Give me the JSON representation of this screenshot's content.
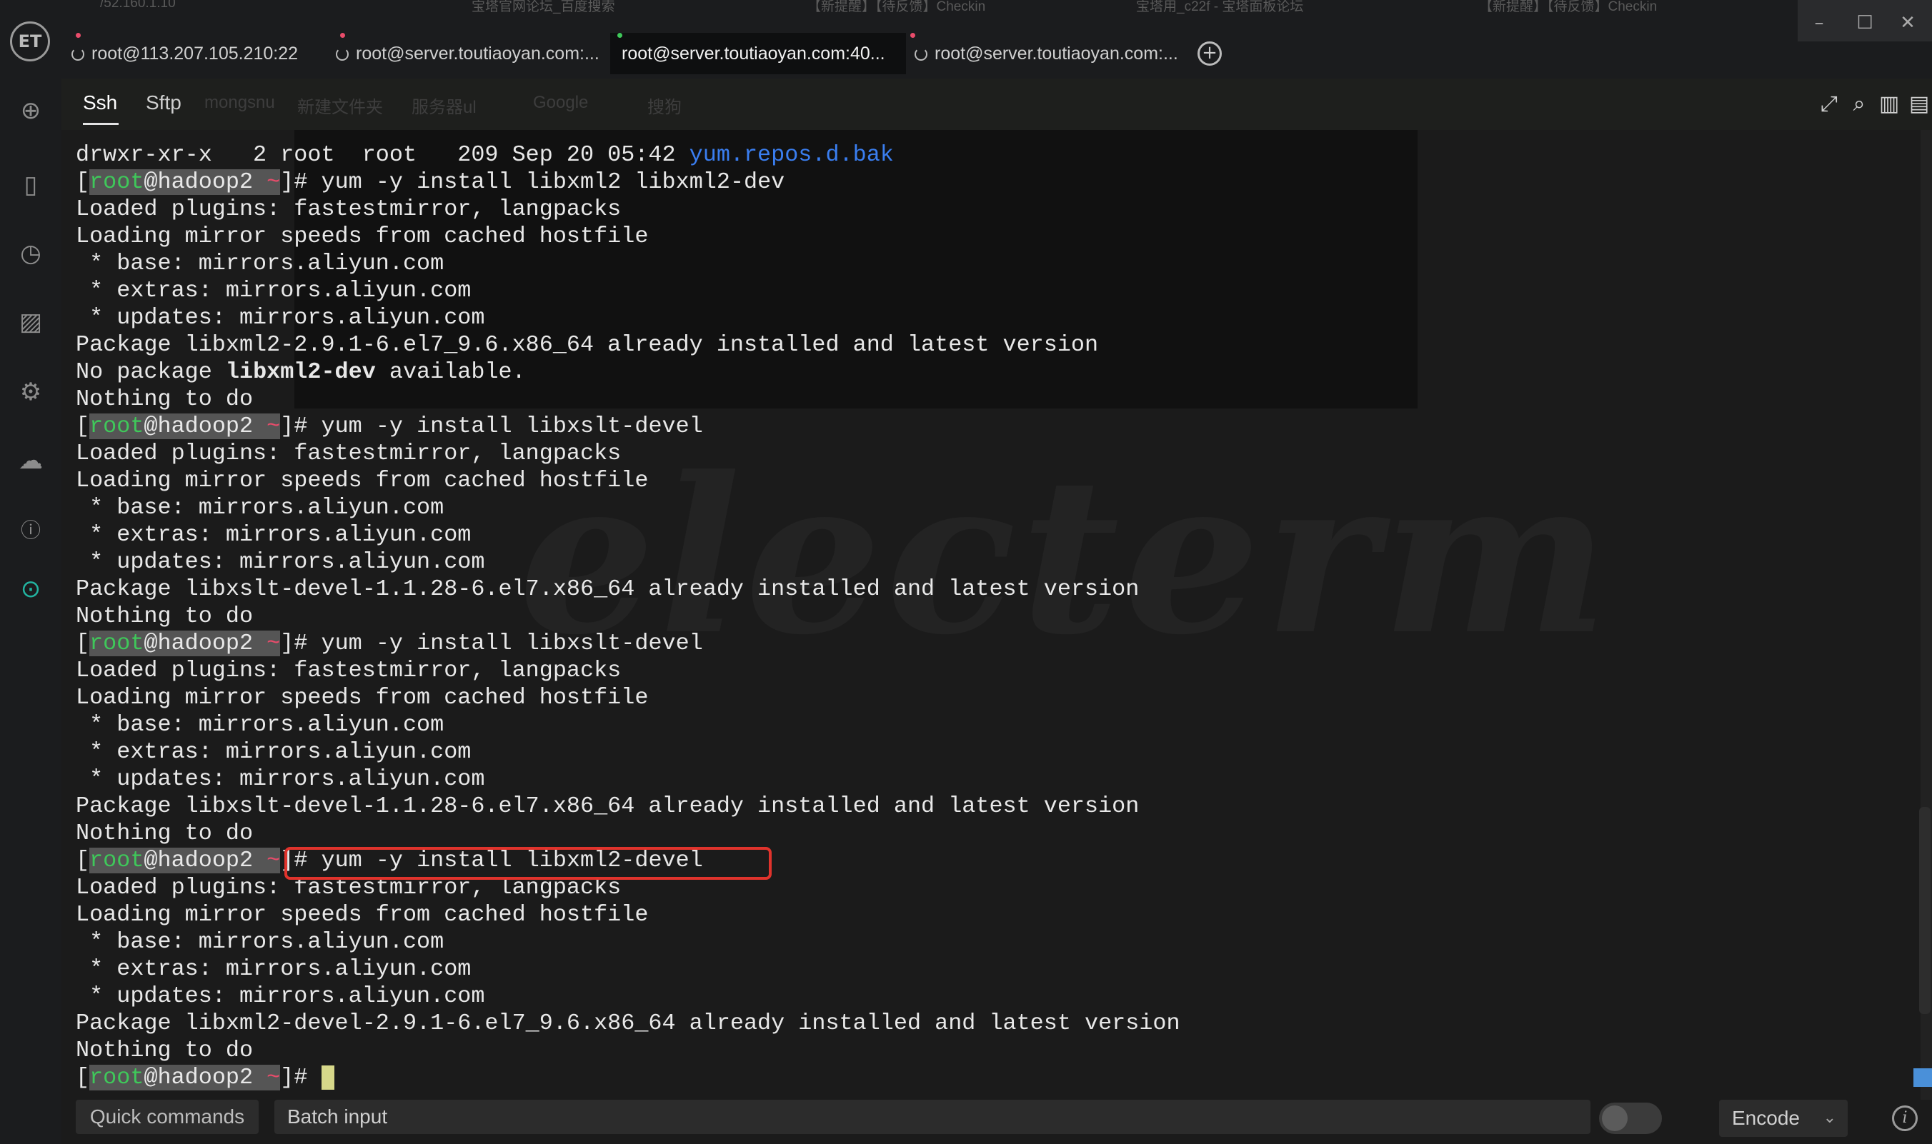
{
  "window": {
    "background_tabs": [
      "/52.160.1.10",
      "宝塔官网论坛_百度搜索",
      "【新提醒】【待反馈】Checkin",
      "宝塔用_c22f - 宝塔面板论坛",
      "【新提醒】【待反馈】Checkin"
    ],
    "controls": [
      "minimize",
      "maximize",
      "close"
    ]
  },
  "app": {
    "logo_text": "ET"
  },
  "tabs": [
    {
      "label": "root@113.207.105.210:22",
      "active": false,
      "dot_color": "#e94c6b"
    },
    {
      "label": "root@server.toutiaoyan.com:...",
      "active": false,
      "dot_color": "#e94c6b"
    },
    {
      "label": "root@server.toutiaoyan.com:40...",
      "active": true,
      "dot_color": "#3fc85a"
    },
    {
      "label": "root@server.toutiaoyan.com:...",
      "active": false,
      "dot_color": "#e94c6b"
    }
  ],
  "sidebar": {
    "icons": [
      "add-icon",
      "bookmark-icon",
      "history-icon",
      "image-icon",
      "settings-icon",
      "cloud-sync-icon",
      "info-icon",
      "upgrade-icon"
    ]
  },
  "subbar": {
    "tabs": [
      "Ssh",
      "Sftp"
    ],
    "active_tab": "Ssh",
    "ghost_bookmarks": [
      "mongsnu",
      "新建文件夹",
      "服务器ul",
      "Google",
      "搜狗"
    ],
    "tools": [
      "fullscreen-icon",
      "search-icon",
      "split-icon",
      "grid-icon"
    ]
  },
  "terminal": {
    "prompt": {
      "user": "root",
      "host": "@hadoop2",
      "dir": "~"
    },
    "lines": [
      {
        "type": "text",
        "text": "drwxr-xr-x   2 root  root   209 Sep 20 05:42 ",
        "link": "yum.repos.d.bak"
      },
      {
        "type": "prompt",
        "cmd": "# yum -y install libxml2 libxml2-dev"
      },
      {
        "type": "text",
        "text": "Loaded plugins: fastestmirror, langpacks"
      },
      {
        "type": "text",
        "text": "Loading mirror speeds from cached hostfile"
      },
      {
        "type": "text",
        "text": " * base: mirrors.aliyun.com"
      },
      {
        "type": "text",
        "text": " * extras: mirrors.aliyun.com"
      },
      {
        "type": "text",
        "text": " * updates: mirrors.aliyun.com"
      },
      {
        "type": "text",
        "text": "Package libxml2-2.9.1-6.el7_9.6.x86_64 already installed and latest version"
      },
      {
        "type": "bold",
        "pre": "No package ",
        "bold": "libxml2-dev",
        "post": " available."
      },
      {
        "type": "text",
        "text": "Nothing to do"
      },
      {
        "type": "prompt",
        "cmd": "# yum -y install libxslt-devel"
      },
      {
        "type": "text",
        "text": "Loaded plugins: fastestmirror, langpacks"
      },
      {
        "type": "text",
        "text": "Loading mirror speeds from cached hostfile"
      },
      {
        "type": "text",
        "text": " * base: mirrors.aliyun.com"
      },
      {
        "type": "text",
        "text": " * extras: mirrors.aliyun.com"
      },
      {
        "type": "text",
        "text": " * updates: mirrors.aliyun.com"
      },
      {
        "type": "text",
        "text": "Package libxslt-devel-1.1.28-6.el7.x86_64 already installed and latest version"
      },
      {
        "type": "text",
        "text": "Nothing to do"
      },
      {
        "type": "prompt",
        "cmd": "# yum -y install libxslt-devel"
      },
      {
        "type": "text",
        "text": "Loaded plugins: fastestmirror, langpacks"
      },
      {
        "type": "text",
        "text": "Loading mirror speeds from cached hostfile"
      },
      {
        "type": "text",
        "text": " * base: mirrors.aliyun.com"
      },
      {
        "type": "text",
        "text": " * extras: mirrors.aliyun.com"
      },
      {
        "type": "text",
        "text": " * updates: mirrors.aliyun.com"
      },
      {
        "type": "text",
        "text": "Package libxslt-devel-1.1.28-6.el7.x86_64 already installed and latest version"
      },
      {
        "type": "text",
        "text": "Nothing to do"
      },
      {
        "type": "prompt",
        "cmd": "# yum -y install libxml2-devel",
        "highlighted": true
      },
      {
        "type": "text",
        "text": "Loaded plugins: fastestmirror, langpacks"
      },
      {
        "type": "text",
        "text": "Loading mirror speeds from cached hostfile"
      },
      {
        "type": "text",
        "text": " * base: mirrors.aliyun.com"
      },
      {
        "type": "text",
        "text": " * extras: mirrors.aliyun.com"
      },
      {
        "type": "text",
        "text": " * updates: mirrors.aliyun.com"
      },
      {
        "type": "text",
        "text": "Package libxml2-devel-2.9.1-6.el7_9.6.x86_64 already installed and latest version"
      },
      {
        "type": "text",
        "text": "Nothing to do"
      },
      {
        "type": "prompt",
        "cmd": "# ",
        "cursor": true
      }
    ],
    "watermark": "electerm",
    "highlight_color": "#e0332c"
  },
  "bottombar": {
    "quick_commands_label": "Quick commands",
    "batch_input_placeholder": "Batch input",
    "encode_label": "Encode"
  },
  "colors": {
    "accent_green": "#3fc85a",
    "accent_red": "#e94c6b",
    "link_blue": "#3a7ef0",
    "cursor": "#d7d88a"
  }
}
